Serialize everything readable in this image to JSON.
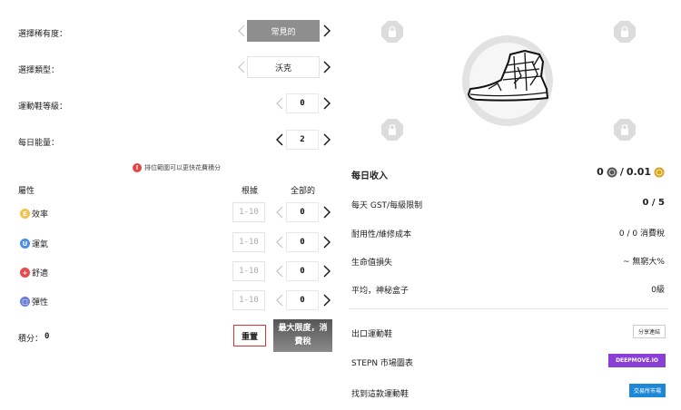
{
  "left": {
    "rarity": {
      "label": "選擇稀有度：",
      "value": "常見的"
    },
    "type": {
      "label": "選擇類型：",
      "value": "沃克"
    },
    "level": {
      "label": "運動鞋等級：",
      "value": "0"
    },
    "energy": {
      "label": "每日能量：",
      "value": "2"
    },
    "warning": "排位範圍可以更快花費積分",
    "attributes": {
      "header": "屬性",
      "col_base": "根據",
      "col_total": "全部的",
      "rows": [
        {
          "name": "效率",
          "icon": "efficiency-icon",
          "color": "#f2c14e",
          "glyph": "E",
          "base": "1-10",
          "value": "0"
        },
        {
          "name": "運氣",
          "icon": "luck-icon",
          "color": "#4a8fe7",
          "glyph": "U",
          "base": "1-10",
          "value": "0"
        },
        {
          "name": "舒適",
          "icon": "comfort-icon",
          "color": "#e74a4a",
          "glyph": "+",
          "base": "1-10",
          "value": "0"
        },
        {
          "name": "彈性",
          "icon": "resilience-icon",
          "color": "#6a7fd6",
          "glyph": "□",
          "base": "1-10",
          "value": "0"
        }
      ]
    },
    "points": {
      "label": "積分：",
      "value": "0"
    },
    "reset_label": "重置",
    "max_label_1": "最大限度，消",
    "max_label_2": "費稅"
  },
  "right": {
    "daily_income": {
      "label": "每日收入",
      "gst": "0",
      "separator": "/",
      "gmt": "0.01"
    },
    "stats": [
      {
        "label": "每天 GST/每級限制",
        "value": "0 / 5"
      },
      {
        "label": "耐用性/維修成本",
        "value": "0 / 0 消費稅"
      },
      {
        "label": "生命值損失",
        "value": "~ 無窮大%"
      },
      {
        "label": "平均，神秘盒子",
        "value": "0級"
      }
    ],
    "links": [
      {
        "label": "出口運動鞋",
        "button": "分享連結"
      },
      {
        "label": "STEPN 市場圖表",
        "button": "DEEPMOVE.IO"
      },
      {
        "label": "找到這款運動鞋",
        "button": "交易所市場"
      }
    ]
  },
  "colors": {
    "deepmove": "#8a3fd6",
    "market": "#1e88d8",
    "reset_border": "#dd3333",
    "warning": "#e04545"
  }
}
